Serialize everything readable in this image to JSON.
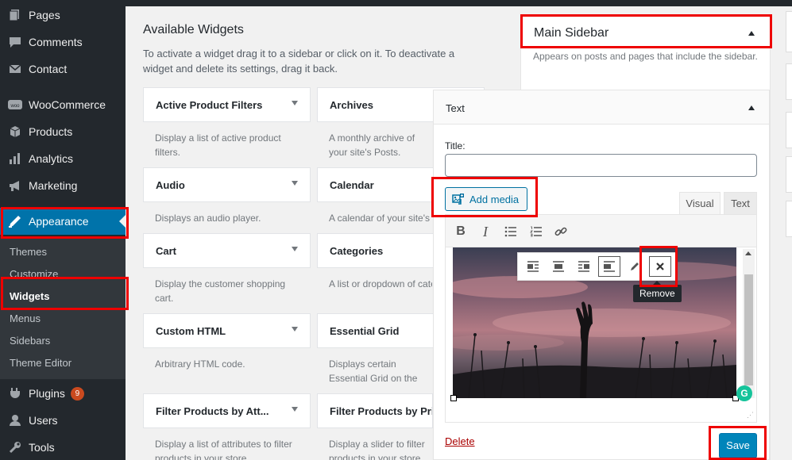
{
  "admin_menu": {
    "items": [
      {
        "label": "Pages",
        "icon": "pages-icon"
      },
      {
        "label": "Comments",
        "icon": "comments-icon"
      },
      {
        "label": "Contact",
        "icon": "contact-icon"
      },
      {
        "label": "WooCommerce",
        "icon": "woocommerce-icon"
      },
      {
        "label": "Products",
        "icon": "products-icon"
      },
      {
        "label": "Analytics",
        "icon": "analytics-icon"
      },
      {
        "label": "Marketing",
        "icon": "marketing-icon"
      },
      {
        "label": "Appearance",
        "icon": "appearance-icon"
      },
      {
        "label": "Plugins",
        "icon": "plugins-icon",
        "badge": "9"
      },
      {
        "label": "Users",
        "icon": "users-icon"
      },
      {
        "label": "Tools",
        "icon": "tools-icon"
      }
    ],
    "submenu": [
      "Themes",
      "Customize",
      "Widgets",
      "Menus",
      "Sidebars",
      "Theme Editor"
    ],
    "current_submenu": "Widgets",
    "colors": {
      "bg": "#23282d",
      "active": "#0073aa",
      "badge": "#ca4a1f"
    }
  },
  "available": {
    "title": "Available Widgets",
    "description": "To activate a widget drag it to a sidebar or click on it. To deactivate a widget and delete its settings, drag it back.",
    "widgets": [
      {
        "title": "Active Product Filters",
        "desc": "Display a list of active product filters."
      },
      {
        "title": "Archives",
        "desc": "A monthly archive of your site's Posts."
      },
      {
        "title": "Audio",
        "desc": "Displays an audio player."
      },
      {
        "title": "Calendar",
        "desc": "A calendar of your site's Posts."
      },
      {
        "title": "Cart",
        "desc": "Display the customer shopping cart."
      },
      {
        "title": "Categories",
        "desc": "A list or dropdown of categories."
      },
      {
        "title": "Custom HTML",
        "desc": "Arbitrary HTML code."
      },
      {
        "title": "Essential Grid",
        "desc": "Displays certain Essential Grid on the page"
      },
      {
        "title": "Filter Products by Att...",
        "desc": "Display a list of attributes to filter products in your store."
      },
      {
        "title": "Filter Products by Price",
        "desc": "Display a slider to filter products in your store by price."
      }
    ]
  },
  "main_sidebar": {
    "title": "Main Sidebar",
    "description": "Appears on posts and pages that include the sidebar."
  },
  "text_widget": {
    "header": "Text",
    "title_label": "Title:",
    "title_value": "",
    "add_media": "Add media",
    "tab_visual": "Visual",
    "tab_text": "Text",
    "toolbar": [
      "bold-icon",
      "italic-icon",
      "bullet-list-icon",
      "numbered-list-icon",
      "link-icon"
    ],
    "toolbar_glyphs": {
      "bold": "B",
      "italic": "I"
    },
    "image_toolbar": [
      "align-left-icon",
      "align-center-icon",
      "align-right-icon",
      "align-none-icon",
      "edit-icon",
      "remove-icon"
    ],
    "tooltip": "Remove",
    "grammarly": "G",
    "delete": "Delete",
    "save": "Save"
  }
}
